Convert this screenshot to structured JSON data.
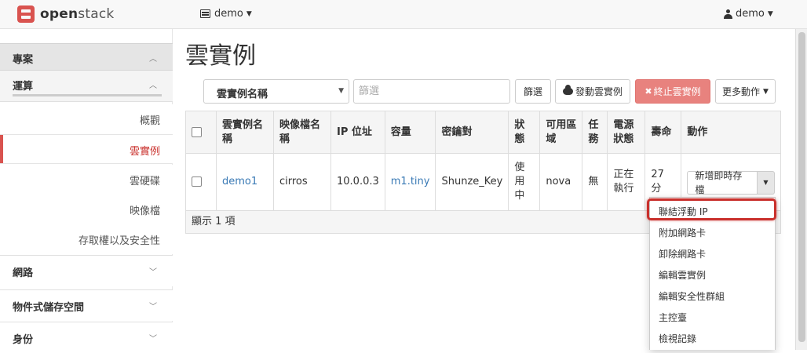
{
  "app": {
    "logo_bold": "open",
    "logo_light": "stack",
    "brand_color": "#d9534f"
  },
  "header": {
    "project": "demo",
    "user": "demo"
  },
  "sidebar": {
    "section": "專案",
    "group": "運算",
    "items": [
      "概觀",
      "雲實例",
      "雲硬碟",
      "映像檔",
      "存取權以及安全性"
    ],
    "active_item": "雲實例",
    "collapsed": [
      "網路",
      "物件式儲存空間",
      "身份"
    ]
  },
  "page": {
    "title": "雲實例"
  },
  "toolbar": {
    "filter_field": "雲實例名稱",
    "filter_placeholder": "篩選",
    "filter_button": "篩選",
    "launch_button": "發動雲實例",
    "terminate_button": "終止雲實例",
    "more_button": "更多動作"
  },
  "table": {
    "headers": [
      "雲實例名稱",
      "映像檔名稱",
      "IP 位址",
      "容量",
      "密鑰對",
      "狀態",
      "可用區域",
      "任務",
      "電源狀態",
      "壽命",
      "動作"
    ],
    "rows": [
      {
        "name": "demo1",
        "image": "cirros",
        "ip": "10.0.0.3",
        "size": "m1.tiny",
        "keypair": "Shunze_Key",
        "status": "使用中",
        "zone": "nova",
        "task": "無",
        "power": "正在執行",
        "age": "27 分",
        "action": "新增即時存檔"
      }
    ],
    "footer": "顯示 1 項"
  },
  "dropdown": {
    "items": [
      "聯結浮動 IP",
      "附加網路卡",
      "卸除網路卡",
      "編輯雲實例",
      "編輯安全性群組",
      "主控臺",
      "檢視記錄"
    ],
    "highlighted": "聯結浮動 IP",
    "highlight_color": "#c9302c"
  }
}
